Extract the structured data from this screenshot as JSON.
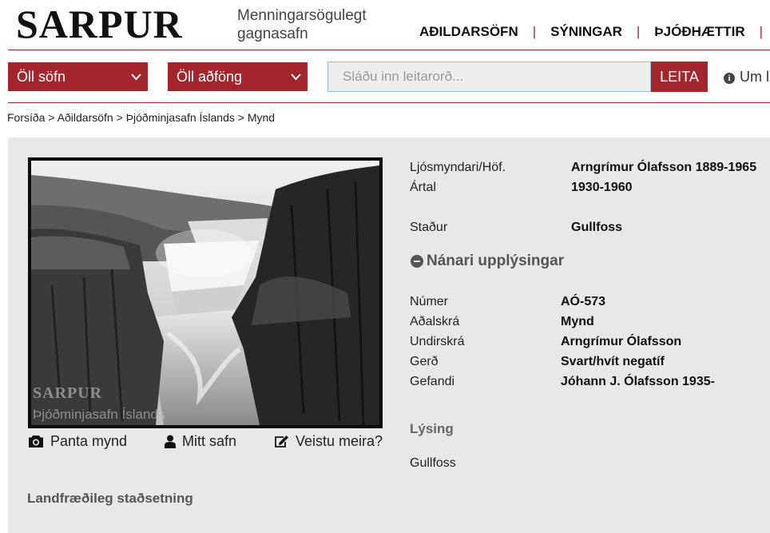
{
  "header": {
    "logo": "SARPUR",
    "tagline_line1": "Menningarsögulegt",
    "tagline_line2": "gagnasafn",
    "nav": [
      "AÐILDARSÖFN",
      "SÝNINGAR",
      "ÞJÓÐHÆTTIR"
    ]
  },
  "search": {
    "filter1": "Öll söfn",
    "filter2": "Öll aðföng",
    "placeholder": "Sláðu inn leitarorð...",
    "button": "LEITA",
    "about": "Um l"
  },
  "breadcrumb": [
    "Forsíða",
    "Aðildarsöfn",
    "Þjóðminjasafn Íslands",
    "Mynd"
  ],
  "breadcrumb_separator": ">",
  "image": {
    "watermark_logo": "SARPUR",
    "watermark_text": "Þjóðminjasafn Íslands"
  },
  "actions": {
    "order": "Panta mynd",
    "my_collection": "Mitt safn",
    "know_more": "Veistu meira?"
  },
  "geo_heading": "Landfræðileg staðsetning",
  "summary": [
    {
      "label": "Ljósmyndari/Höf.",
      "value": "Arngrímur Ólafsson 1889-1965"
    },
    {
      "label": "Ártal",
      "value": "1930-1960"
    },
    {
      "label": "Staður",
      "value": "Gullfoss"
    }
  ],
  "more_info_toggle": "Nánari upplýsingar",
  "details": [
    {
      "label": "Númer",
      "value": "AÓ-573"
    },
    {
      "label": "Aðalskrá",
      "value": "Mynd"
    },
    {
      "label": "Undirskrá",
      "value": "Arngrímur Ólafsson"
    },
    {
      "label": "Gerð",
      "value": "Svart/hvít negatíf"
    },
    {
      "label": "Gefandi",
      "value": "Jóhann J. Ólafsson 1935-"
    }
  ],
  "description_heading": "Lýsing",
  "description": "Gullfoss",
  "colors": {
    "brand_red": "#a3262c",
    "panel_gray": "#e8e8e8",
    "input_border": "#9bbad6"
  },
  "icons": [
    "camera-icon",
    "user-icon",
    "edit-icon",
    "info-icon",
    "minus-circle-icon",
    "chevron-down-icon"
  ]
}
